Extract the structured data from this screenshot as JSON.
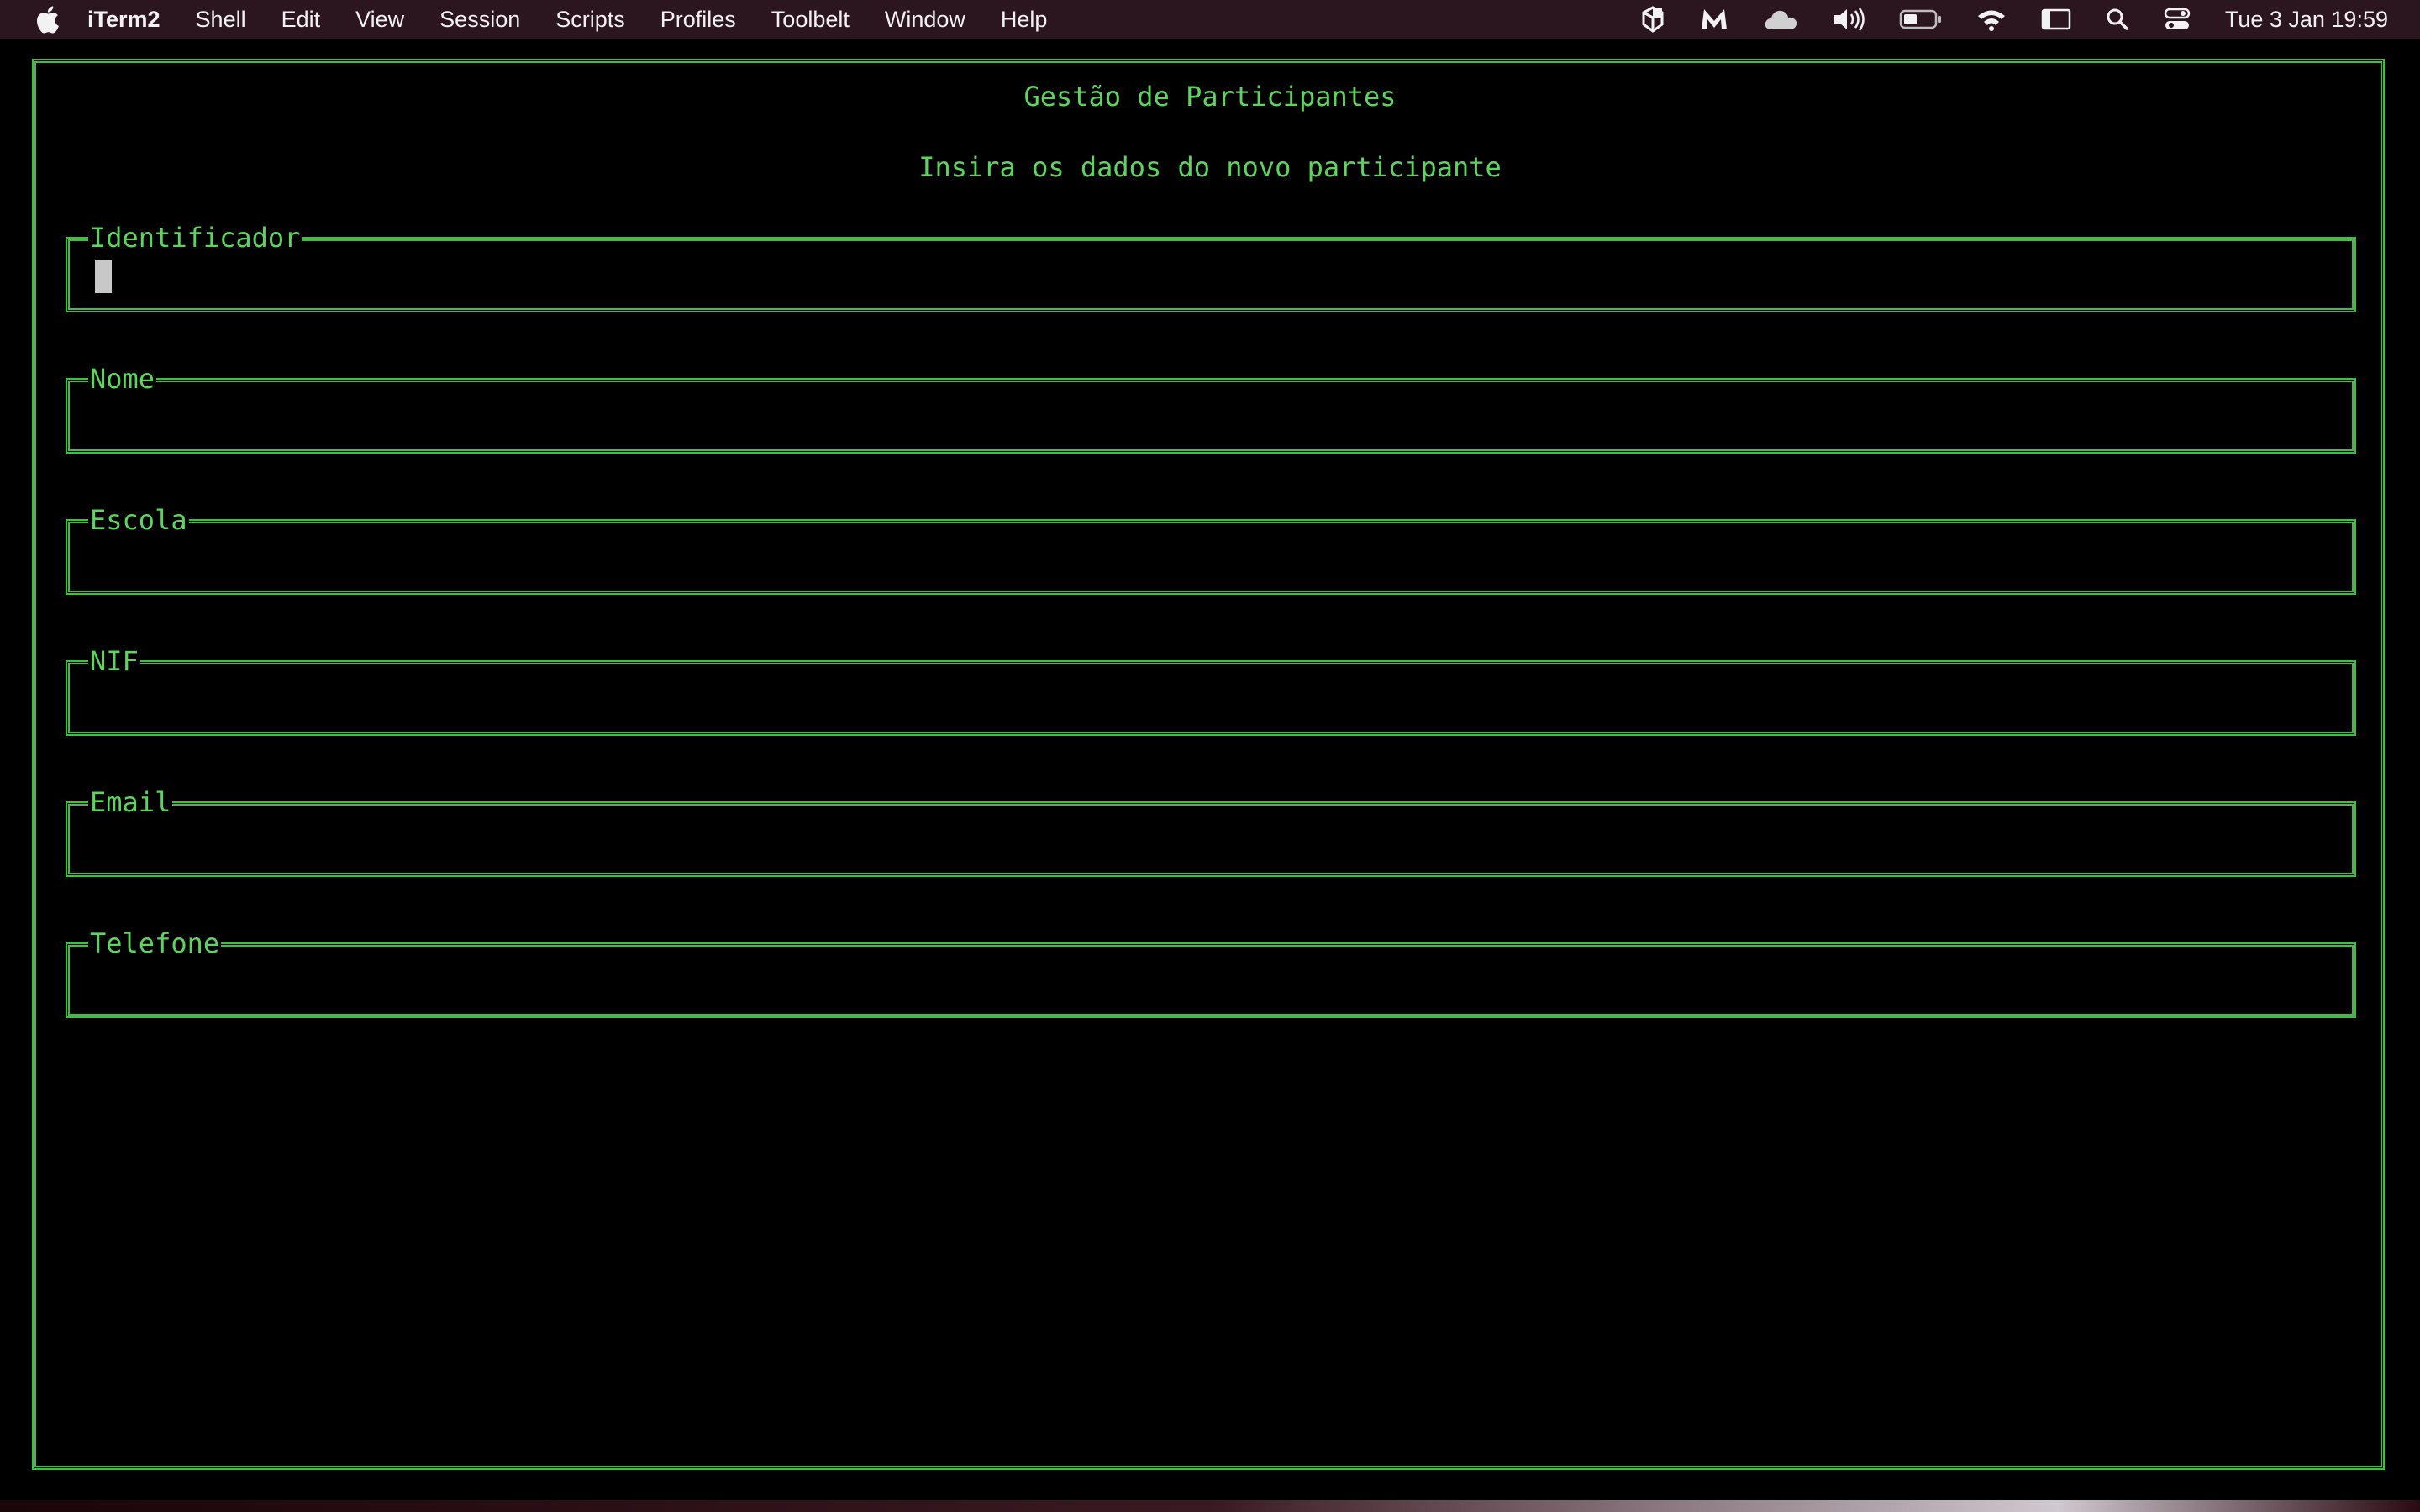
{
  "menubar": {
    "app_name": "iTerm2",
    "items": [
      "Shell",
      "Edit",
      "View",
      "Session",
      "Scripts",
      "Profiles",
      "Toolbelt",
      "Window",
      "Help"
    ],
    "clock": "Tue 3 Jan  19:59",
    "status_icons": [
      "app-box-icon",
      "malwarebytes-icon",
      "cloud-icon",
      "volume-icon",
      "battery-icon",
      "wifi-icon",
      "sidebar-icon",
      "search-icon",
      "control-center-icon"
    ]
  },
  "terminal": {
    "title": "Gestão de Participantes",
    "subtitle": "Insira os dados do novo participante",
    "text_color": "#5fd35f",
    "border_color": "#3fbf3f",
    "fields": [
      {
        "label": "Identificador",
        "value": "",
        "focused": true
      },
      {
        "label": "Nome",
        "value": ""
      },
      {
        "label": "Escola",
        "value": ""
      },
      {
        "label": "NIF",
        "value": ""
      },
      {
        "label": "Email",
        "value": ""
      },
      {
        "label": "Telefone",
        "value": ""
      }
    ]
  }
}
